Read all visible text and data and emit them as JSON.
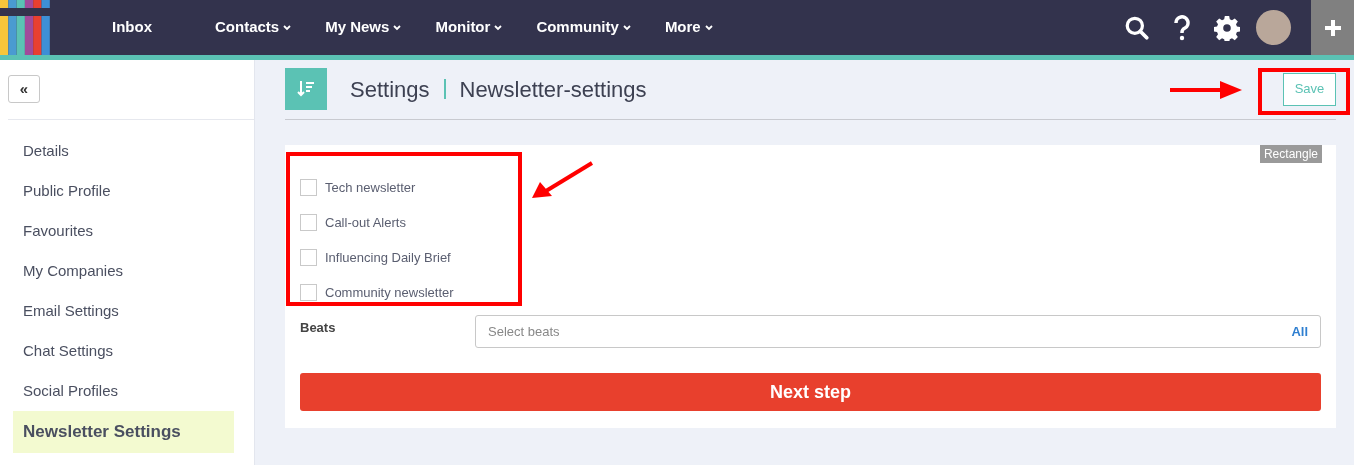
{
  "nav": {
    "items": [
      {
        "label": "Inbox",
        "dropdown": false
      },
      {
        "label": "Contacts",
        "dropdown": true
      },
      {
        "label": "My News",
        "dropdown": true
      },
      {
        "label": "Monitor",
        "dropdown": true
      },
      {
        "label": "Community",
        "dropdown": true
      },
      {
        "label": "More",
        "dropdown": true
      }
    ]
  },
  "sidebar": {
    "collapse_button": "«",
    "items": [
      {
        "label": "Details",
        "selected": false
      },
      {
        "label": "Public Profile",
        "selected": false
      },
      {
        "label": "Favourites",
        "selected": false
      },
      {
        "label": "My Companies",
        "selected": false
      },
      {
        "label": "Email Settings",
        "selected": false
      },
      {
        "label": "Chat Settings",
        "selected": false
      },
      {
        "label": "Social Profiles",
        "selected": false
      },
      {
        "label": "Newsletter Settings",
        "selected": true
      }
    ]
  },
  "header": {
    "breadcrumb": [
      "Settings",
      "Newsletter-settings"
    ],
    "save_button": "Save"
  },
  "form": {
    "tag": "Rectangle",
    "newsletters": [
      {
        "label": "Tech newsletter",
        "checked": false
      },
      {
        "label": "Call-out Alerts",
        "checked": false
      },
      {
        "label": "Influencing Daily Brief",
        "checked": false
      },
      {
        "label": "Community newsletter",
        "checked": false
      }
    ],
    "beats": {
      "label": "Beats",
      "placeholder": "Select beats",
      "all_link": "All"
    },
    "next_button": "Next step"
  }
}
